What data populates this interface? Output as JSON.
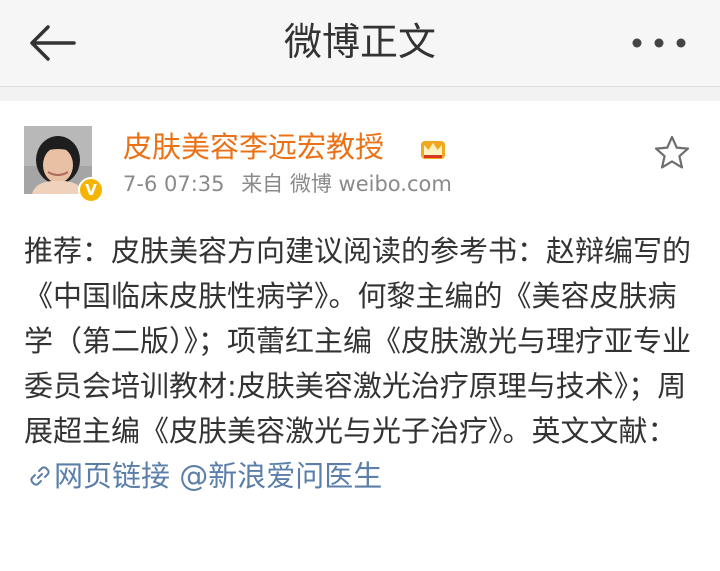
{
  "header": {
    "title": "微博正文"
  },
  "post": {
    "author": "皮肤美容李远宏教授",
    "verified_badge": "V",
    "time": "7-6 07:35",
    "source": "来自 微博 weibo.com",
    "text_main": "推荐：皮肤美容方向建议阅读的参考书：赵辩编写的《中国临床皮肤性病学》。何黎主编的《美容皮肤病学（第二版）》；项蕾红主编《皮肤激光与理疗亚专业委员会培训教材:皮肤美容激光治疗原理与技术》；周展超主编《皮肤美容激光与光子治疗》。英文文献：",
    "web_link": "网页链接",
    "mention": "@新浪爱问医生"
  },
  "colors": {
    "author": "#ea7115",
    "link": "#5b7fa9",
    "badge": "#f5b400",
    "text": "#333333"
  },
  "icons": [
    "back-arrow-icon",
    "more-dots-icon",
    "crown-icon",
    "star-icon",
    "link-icon"
  ]
}
